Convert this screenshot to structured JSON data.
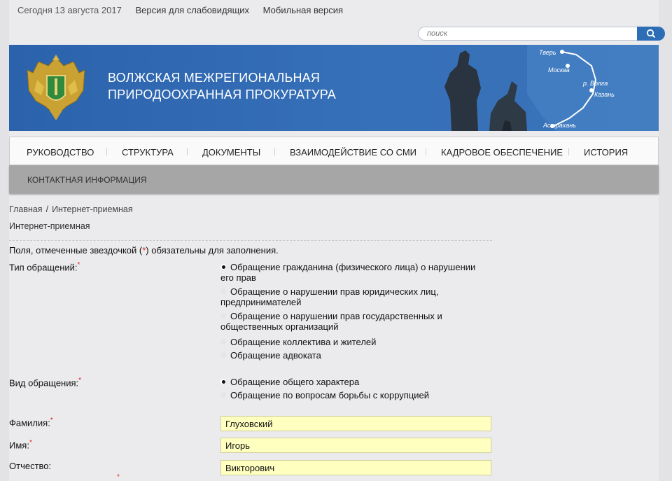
{
  "topbar": {
    "date": "Сегодня 13 августа 2017",
    "accessible_link": "Версия для слабовидящих",
    "mobile_link": "Мобильная версия"
  },
  "search": {
    "placeholder": "поиск"
  },
  "banner": {
    "title_line1": "ВОЛЖСКАЯ МЕЖРЕГИОНАЛЬНАЯ",
    "title_line2": "ПРИРОДООХРАННАЯ ПРОКУРАТУРА",
    "map_labels": [
      "Тверь",
      "Москва",
      "р. Волга",
      "Казань",
      "Астрахань"
    ]
  },
  "nav": {
    "items": [
      "РУКОВОДСТВО",
      "СТРУКТУРА",
      "ДОКУМЕНТЫ",
      "ВЗАИМОДЕЙСТВИЕ СО СМИ",
      "КАДРОВОЕ ОБЕСПЕЧЕНИЕ",
      "ИСТОРИЯ"
    ],
    "row2_item": "КОНТАКТНАЯ ИНФОРМАЦИЯ"
  },
  "breadcrumbs": {
    "home": "Главная",
    "sep": "/",
    "current": "Интернет-приемная"
  },
  "page_title": "Интернет-приемная",
  "form": {
    "note_before": "Поля, отмеченные звездочкой (",
    "note_star": "*",
    "note_after": ") обязательны для заполнения.",
    "type_label": "Тип обращений:",
    "type_options": [
      "Обращение гражданина (физического лица) о нарушении его прав",
      "Обращение о нарушении прав юридических лиц, предпринимателей",
      "Обращение о нарушении прав государственных и общественных организаций",
      "Обращение коллектива и жителей",
      "Обращение адвоката"
    ],
    "kind_label": "Вид обращения:",
    "kind_options": [
      "Обращение общего характера",
      "Обращение по вопросам борьбы с коррупцией"
    ],
    "surname_label": "Фамилия:",
    "surname_value": "Глуховский",
    "name_label": "Имя:",
    "name_value": "Игорь",
    "patronymic_label": "Отчество:",
    "patronymic_value": "Викторович",
    "required_mark": "*"
  }
}
